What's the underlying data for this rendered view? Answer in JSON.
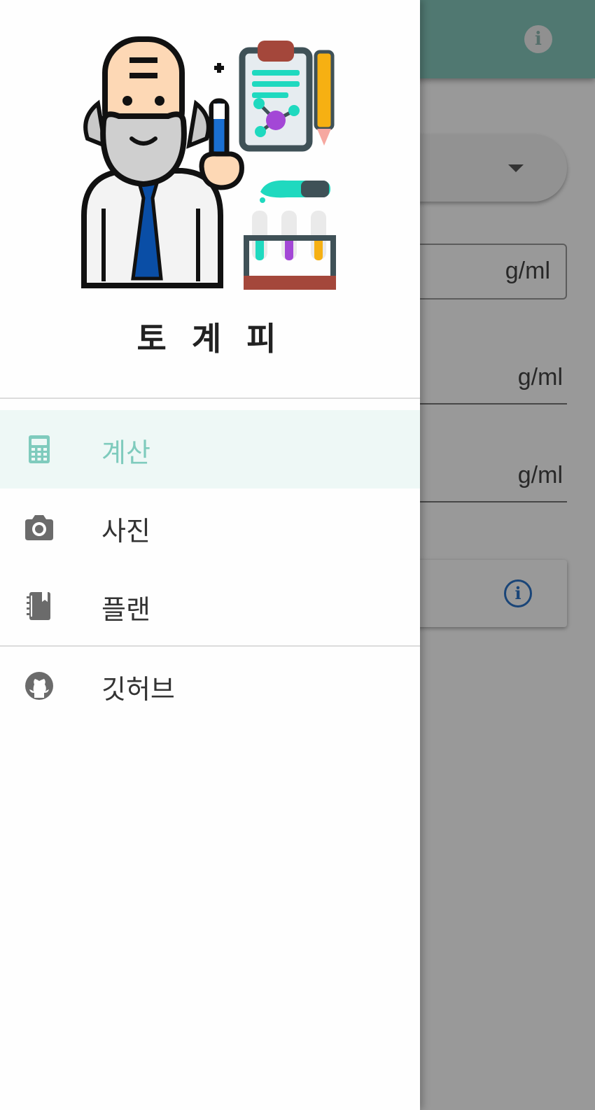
{
  "app": {
    "units": {
      "density_1": "g/ml",
      "density_2": "g/ml",
      "density_3": "g/ml"
    }
  },
  "drawer": {
    "title": "토 계 피",
    "items": [
      {
        "label": "계산",
        "icon": "calculator-icon",
        "active": true
      },
      {
        "label": "사진",
        "icon": "camera-icon",
        "active": false
      },
      {
        "label": "플랜",
        "icon": "notebook-icon",
        "active": false
      },
      {
        "label": "깃허브",
        "icon": "github-icon",
        "active": false
      }
    ]
  },
  "colors": {
    "appbar": "#85c8bd",
    "accent": "#7fcbbd",
    "active_bg": "#eef8f6",
    "info_blue": "#2c74c9",
    "icon_gray": "#6b6b6b"
  }
}
